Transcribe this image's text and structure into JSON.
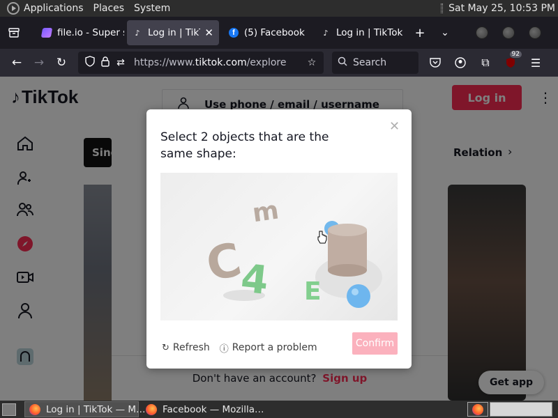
{
  "top_panel": {
    "menus": [
      "Applications",
      "Places",
      "System"
    ],
    "clock": "Sat May 25, 10:53 PM"
  },
  "tabs": [
    {
      "label": "file.io - Super s",
      "favicon": "fileio-icon"
    },
    {
      "label": "Log in | TikTok",
      "favicon": "tiktok-icon",
      "active": true
    },
    {
      "label": "(5) Facebook",
      "favicon": "facebook-icon"
    },
    {
      "label": "Log in | TikTok",
      "favicon": "tiktok-icon"
    }
  ],
  "navbar": {
    "url_prefix": "https://www.",
    "url_host": "tiktok.com",
    "url_path": "/explore",
    "search_placeholder": "Search",
    "extension_badge": "92"
  },
  "page": {
    "logo_text": "TikTok",
    "login_button": "Log in",
    "chip_dark": "Sing",
    "chip_relation": "Relation",
    "get_app": "Get app",
    "login_modal": {
      "phone_option": "Use phone / email / username",
      "no_account": "Don't have an account?",
      "signup": "Sign up"
    }
  },
  "captcha": {
    "title": "Select 2 objects that are the same shape:",
    "refresh": "Refresh",
    "report": "Report a problem",
    "confirm": "Confirm",
    "objects": [
      {
        "glyph": "m",
        "color": "#b8aaa0"
      },
      {
        "glyph": "C",
        "color": "#b8a89c"
      },
      {
        "glyph": "4",
        "color": "#7ec98a"
      },
      {
        "glyph": "E",
        "color": "#82cf8e"
      },
      {
        "shape": "cylinder",
        "color": "#c0ada2"
      },
      {
        "shape": "sphere",
        "color": "#6eb6ee"
      }
    ]
  },
  "taskbar": {
    "tasks": [
      "Log in | TikTok — M…",
      "Facebook — Mozilla…"
    ]
  },
  "colors": {
    "tiktok_red": "#fe2c55",
    "confirm_disabled": "#fbb1bd"
  }
}
